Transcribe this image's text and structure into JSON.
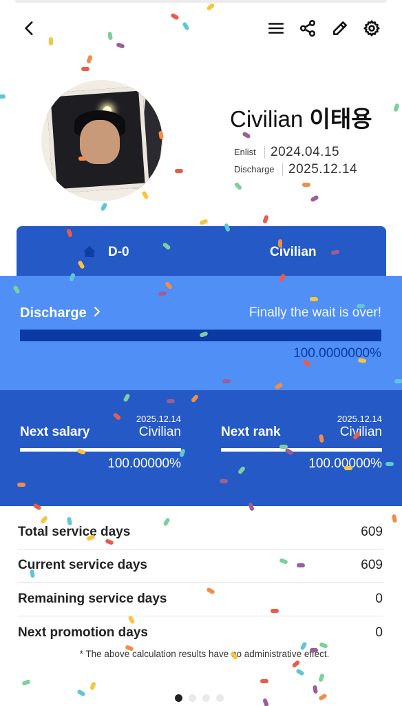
{
  "header": {
    "back_icon": "chevron-left-icon",
    "menu_icon": "hamburger-menu-icon",
    "share_icon": "share-icon",
    "edit_icon": "pencil-icon",
    "settings_icon": "gear-icon"
  },
  "profile": {
    "rank": "Civilian",
    "name": "이태용",
    "enlist_label": "Enlist",
    "enlist_date": "2024.04.15",
    "discharge_label": "Discharge",
    "discharge_date": "2025.12.14"
  },
  "dday": {
    "home_icon": "home-icon",
    "text": "D-0",
    "status": "Civilian"
  },
  "progress": {
    "link_label": "Discharge",
    "link_icon": "chevron-right-icon",
    "message": "Finally the wait is over!",
    "percent_text": "100.0000000%",
    "fraction": 1.0
  },
  "next": {
    "salary": {
      "title": "Next salary",
      "date": "2025.12.14",
      "value": "Civilian",
      "percent_text": "100.00000%",
      "fraction": 1.0
    },
    "rank": {
      "title": "Next rank",
      "date": "2025.12.14",
      "value": "Civilian",
      "percent_text": "100.00000%",
      "fraction": 1.0
    }
  },
  "stats": [
    {
      "label": "Total service days",
      "value": "609"
    },
    {
      "label": "Current service days",
      "value": "609"
    },
    {
      "label": "Remaining service days",
      "value": "0"
    },
    {
      "label": "Next promotion days",
      "value": "0"
    }
  ],
  "disclaimer": "* The above calculation results have no administrative effect.",
  "pager": {
    "count": 4,
    "active_index": 0
  },
  "colors": {
    "dday_blue": "#2459c6",
    "progress_blue": "#4f8ff6",
    "bar_fill": "#0a3aa3",
    "confetti": [
      "#e85d4a",
      "#f5c542",
      "#5fc6d6",
      "#7ecf9b",
      "#9a5f97",
      "#f08d4b"
    ]
  }
}
